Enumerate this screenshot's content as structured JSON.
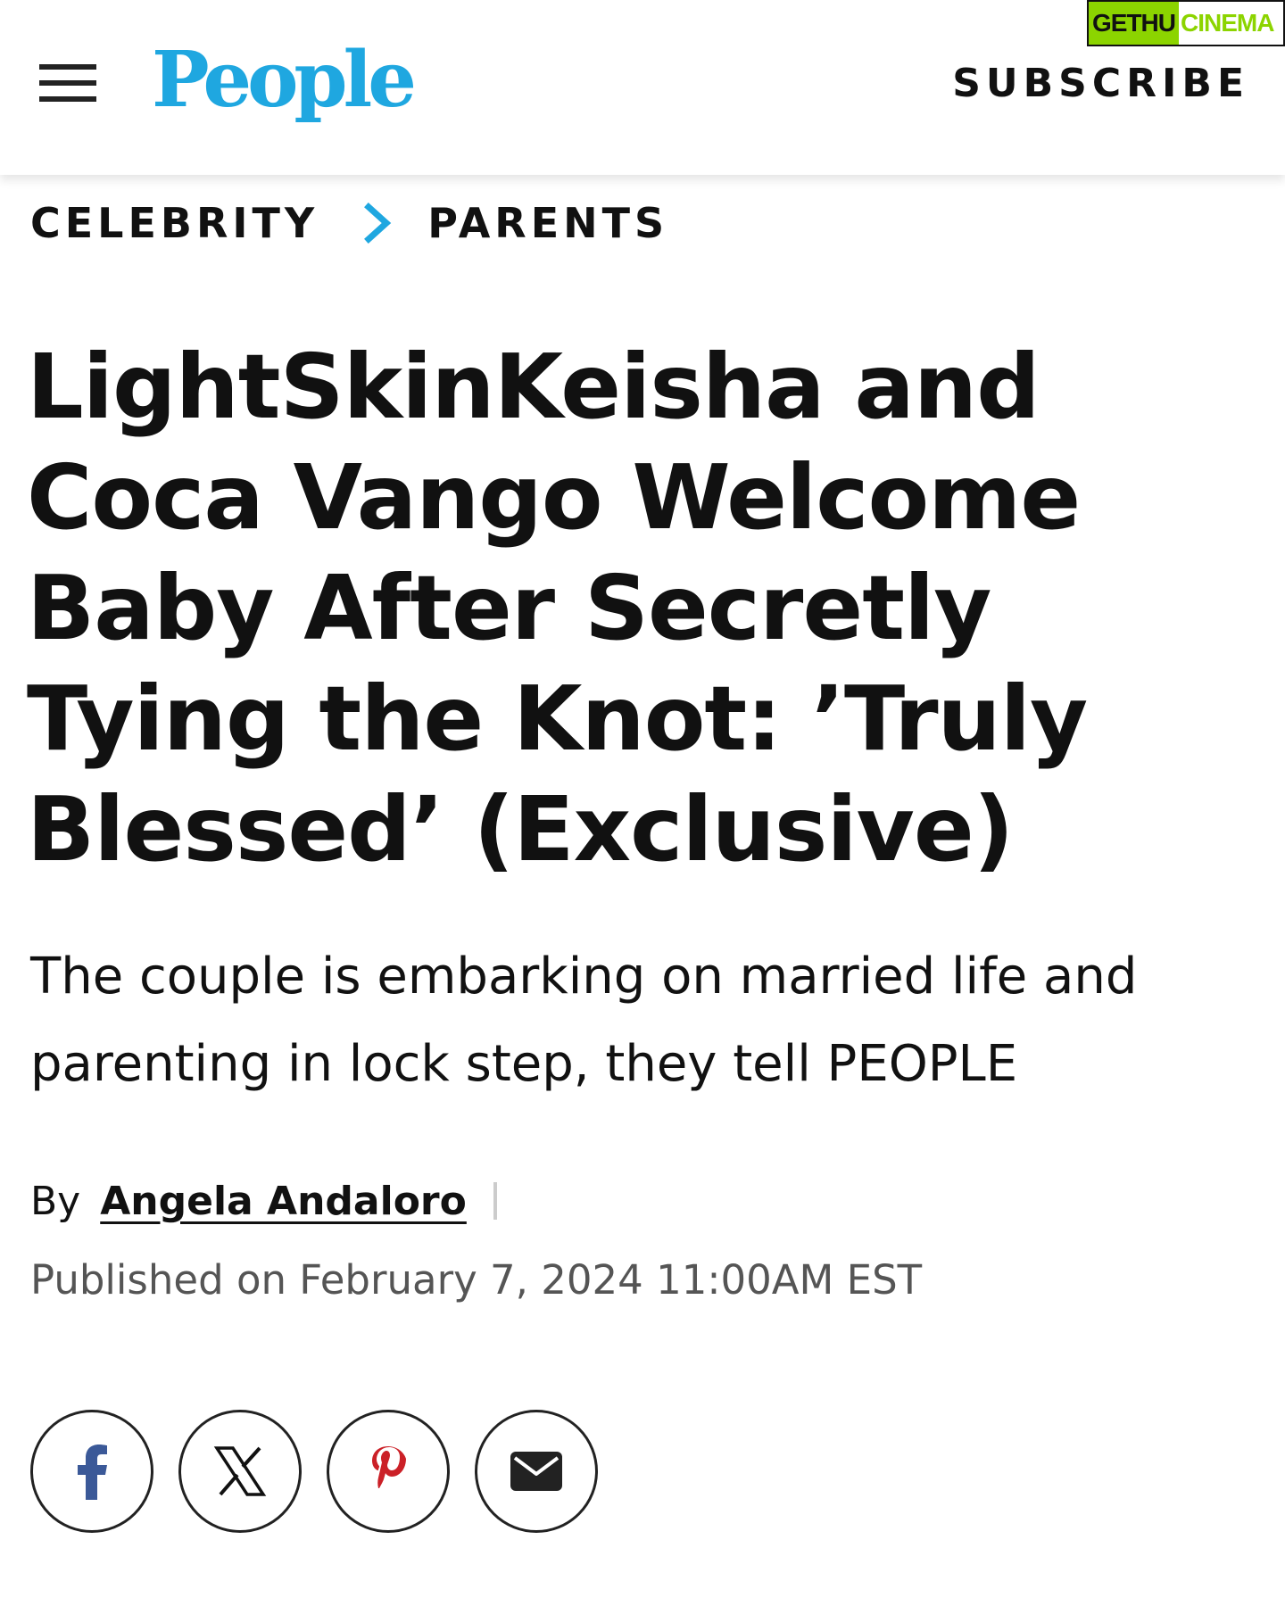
{
  "header": {
    "menu_icon": "hamburger-menu-icon",
    "logo_text": "People",
    "logo_color": "#1fa7e0",
    "subscribe_label": "SUBSCRIBE"
  },
  "watermark": {
    "part1": "GETHU",
    "part2": "CINEMA",
    "color": "#8cd400"
  },
  "breadcrumb": {
    "items": [
      "CELEBRITY",
      "PARENTS"
    ],
    "separator_icon": "chevron-right-icon",
    "separator_color": "#1fa7e0"
  },
  "article": {
    "headline": "LightSkinKeisha and Coca Vango Welcome Baby After Secretly Tying the Knot: ’Truly Blessed’ (Exclusive)",
    "dek": "The couple is embarking on married life and parenting in lock step, they tell PEOPLE",
    "byline_prefix": "By",
    "author": "Angela Andaloro",
    "published": "Published on February 7, 2024 11:00AM EST"
  },
  "share": {
    "buttons": [
      {
        "icon": "facebook-icon",
        "color": "#3b5998"
      },
      {
        "icon": "x-icon",
        "color": "#111111"
      },
      {
        "icon": "pinterest-icon",
        "color": "#cb2027"
      },
      {
        "icon": "email-icon",
        "color": "#222222"
      }
    ]
  }
}
